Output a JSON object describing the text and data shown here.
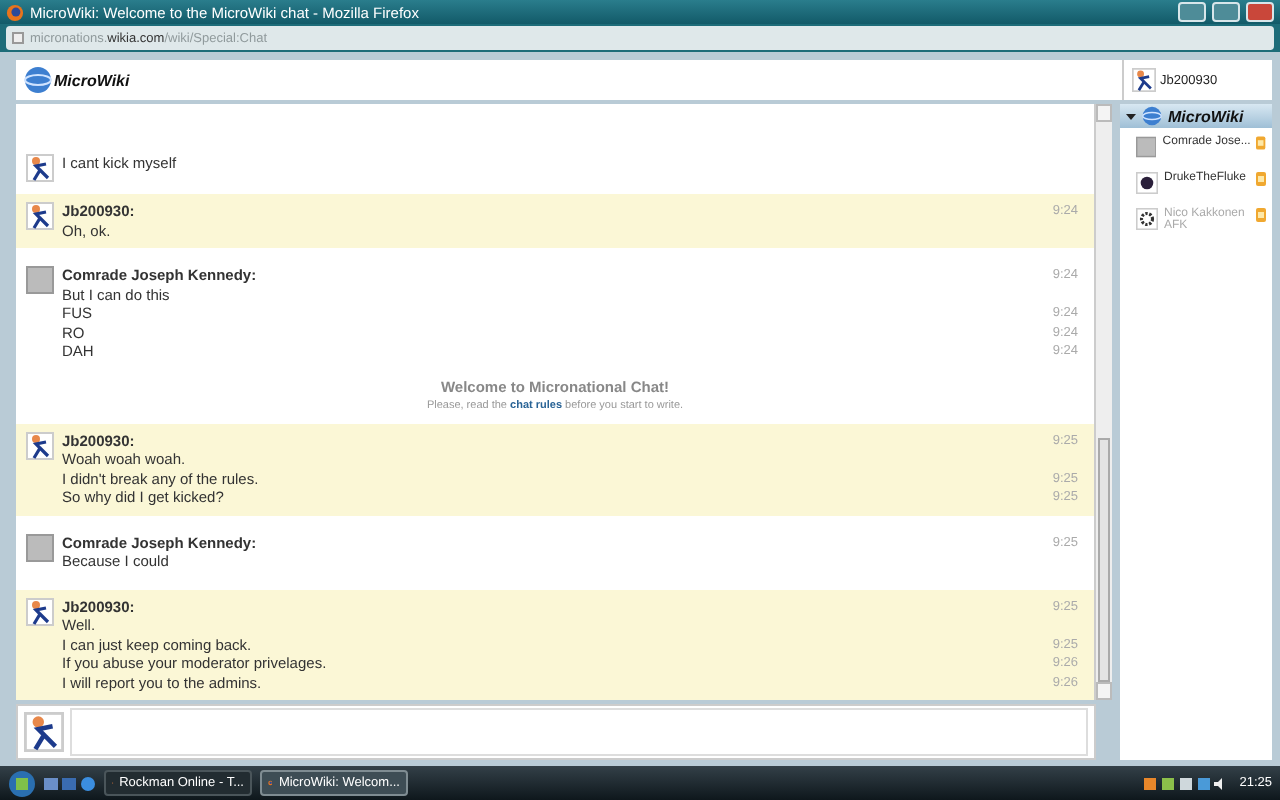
{
  "window": {
    "title": "MicroWiki: Welcome to the MicroWiki chat - Mozilla Firefox"
  },
  "address_bar": {
    "subdomain": "micronations.",
    "domain": "wikia.com",
    "path": "/wiki/Special:Chat"
  },
  "header": {
    "logo": "MicroWiki",
    "user": {
      "name": "Jb200930",
      "avatar": {
        "kind": "runner"
      }
    }
  },
  "chat": {
    "items": [
      {
        "kind": "fragment",
        "avatar": {
          "kind": "runner"
        },
        "text": "I cant kick myself"
      },
      {
        "kind": "message",
        "own": true,
        "user": "Jb200930:",
        "avatar": {
          "kind": "runner"
        },
        "time": "9:24",
        "lines": [
          {
            "text": "Oh, ok."
          }
        ]
      },
      {
        "kind": "message",
        "own": false,
        "user": "Comrade Joseph Kennedy:",
        "avatar": {
          "kind": "photo"
        },
        "time": "9:24",
        "lines": [
          {
            "text": "But I can do this"
          },
          {
            "text": "FUS",
            "time": "9:24"
          },
          {
            "text": "RO",
            "time": "9:24"
          },
          {
            "text": "DAH",
            "time": "9:24"
          }
        ]
      },
      {
        "kind": "notice",
        "title": "Welcome to Micronational Chat!",
        "before": "Please, read the ",
        "link": "chat rules",
        "after": " before you start to write."
      },
      {
        "kind": "message",
        "own": true,
        "user": "Jb200930:",
        "avatar": {
          "kind": "runner"
        },
        "time": "9:25",
        "lines": [
          {
            "text": "Woah woah woah."
          },
          {
            "text": "I didn't break any of the rules.",
            "time": "9:25"
          },
          {
            "text": "So why did I get kicked?",
            "time": "9:25"
          }
        ]
      },
      {
        "kind": "message",
        "own": false,
        "user": "Comrade Joseph Kennedy:",
        "avatar": {
          "kind": "photo"
        },
        "time": "9:25",
        "lines": [
          {
            "text": "Because I could"
          }
        ]
      },
      {
        "kind": "message",
        "own": true,
        "user": "Jb200930:",
        "avatar": {
          "kind": "runner"
        },
        "time": "9:25",
        "lines": [
          {
            "text": "Well."
          },
          {
            "text": "I can just keep coming back.",
            "time": "9:25"
          },
          {
            "text": "If you abuse your moderator privelages.",
            "time": "9:26"
          },
          {
            "text": "I will report you to the admins.",
            "time": "9:26"
          }
        ]
      }
    ]
  },
  "sidebar": {
    "title": "MicroWiki",
    "expanded": true,
    "users": [
      {
        "name": "Comrade Jose...",
        "avatar": {
          "kind": "photo"
        },
        "away": false,
        "moderator": true
      },
      {
        "name": "DrukeTheFluke",
        "avatar": {
          "kind": "orb"
        },
        "away": false,
        "moderator": true
      },
      {
        "name": "Nico Kakkonen",
        "status": "AFK",
        "avatar": {
          "kind": "gear"
        },
        "away": true,
        "moderator": true
      }
    ]
  },
  "input": {
    "avatar": {
      "kind": "runner"
    }
  },
  "taskbar": {
    "tasks": [
      {
        "label": "Rockman Online - T...",
        "selected": false
      },
      {
        "label": "MicroWiki: Welcom...",
        "selected": true
      }
    ],
    "clock": "21:25"
  }
}
